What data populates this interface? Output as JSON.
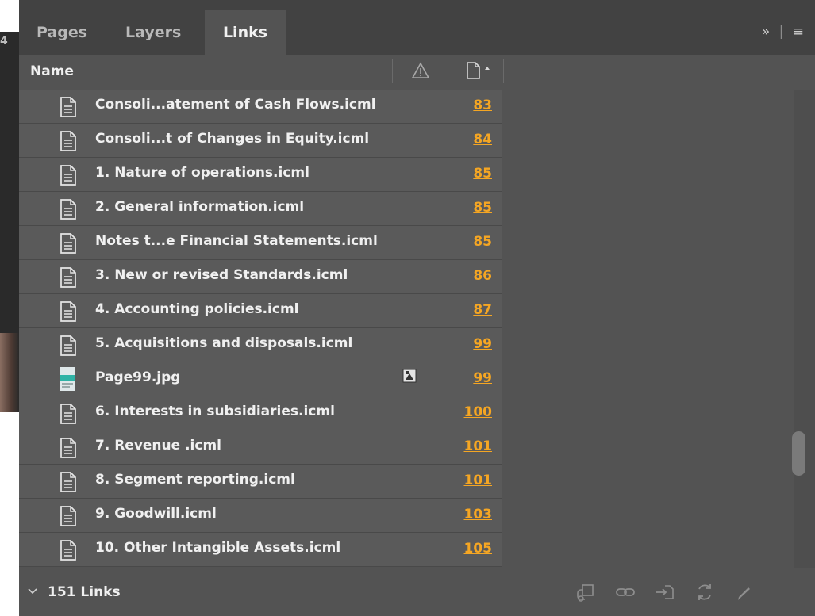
{
  "background": {
    "partial_digit": "4"
  },
  "tabs": [
    {
      "label": "Pages",
      "active": false
    },
    {
      "label": "Layers",
      "active": false
    },
    {
      "label": "Links",
      "active": true
    }
  ],
  "tabbar": {
    "expand_glyph": "»",
    "separator": "|",
    "menu_glyph": "≡"
  },
  "header": {
    "name_label": "Name"
  },
  "links": [
    {
      "name": "Consoli...atement of Cash Flows.icml",
      "page": "83",
      "type": "document"
    },
    {
      "name": "Consoli...t of Changes in Equity.icml",
      "page": "84",
      "type": "document"
    },
    {
      "name": "1. Nature of operations.icml",
      "page": "85",
      "type": "document"
    },
    {
      "name": "2. General information.icml",
      "page": "85",
      "type": "document"
    },
    {
      "name": "Notes t...e Financial Statements.icml",
      "page": "85",
      "type": "document"
    },
    {
      "name": "3. New or revised Standards.icml",
      "page": "86",
      "type": "document"
    },
    {
      "name": "4. Accounting policies.icml",
      "page": "87",
      "type": "document"
    },
    {
      "name": "5. Acquisitions and disposals.icml",
      "page": "99",
      "type": "document"
    },
    {
      "name": "Page99.jpg",
      "page": "99",
      "type": "image",
      "status": "embedded-icon"
    },
    {
      "name": "6. Interests in subsidiaries.icml",
      "page": "100",
      "type": "document"
    },
    {
      "name": "7. Revenue .icml",
      "page": "101",
      "type": "document"
    },
    {
      "name": "8. Segment reporting.icml",
      "page": "101",
      "type": "document"
    },
    {
      "name": "9. Goodwill.icml",
      "page": "103",
      "type": "document"
    },
    {
      "name": "10. Other Intangible Assets.icml",
      "page": "105",
      "type": "document"
    }
  ],
  "footer": {
    "links_count": "151 Links"
  },
  "colors": {
    "panel": "#535353",
    "tabbar": "#424242",
    "page_link": "#f5a623",
    "text": "#f0f0f0"
  }
}
